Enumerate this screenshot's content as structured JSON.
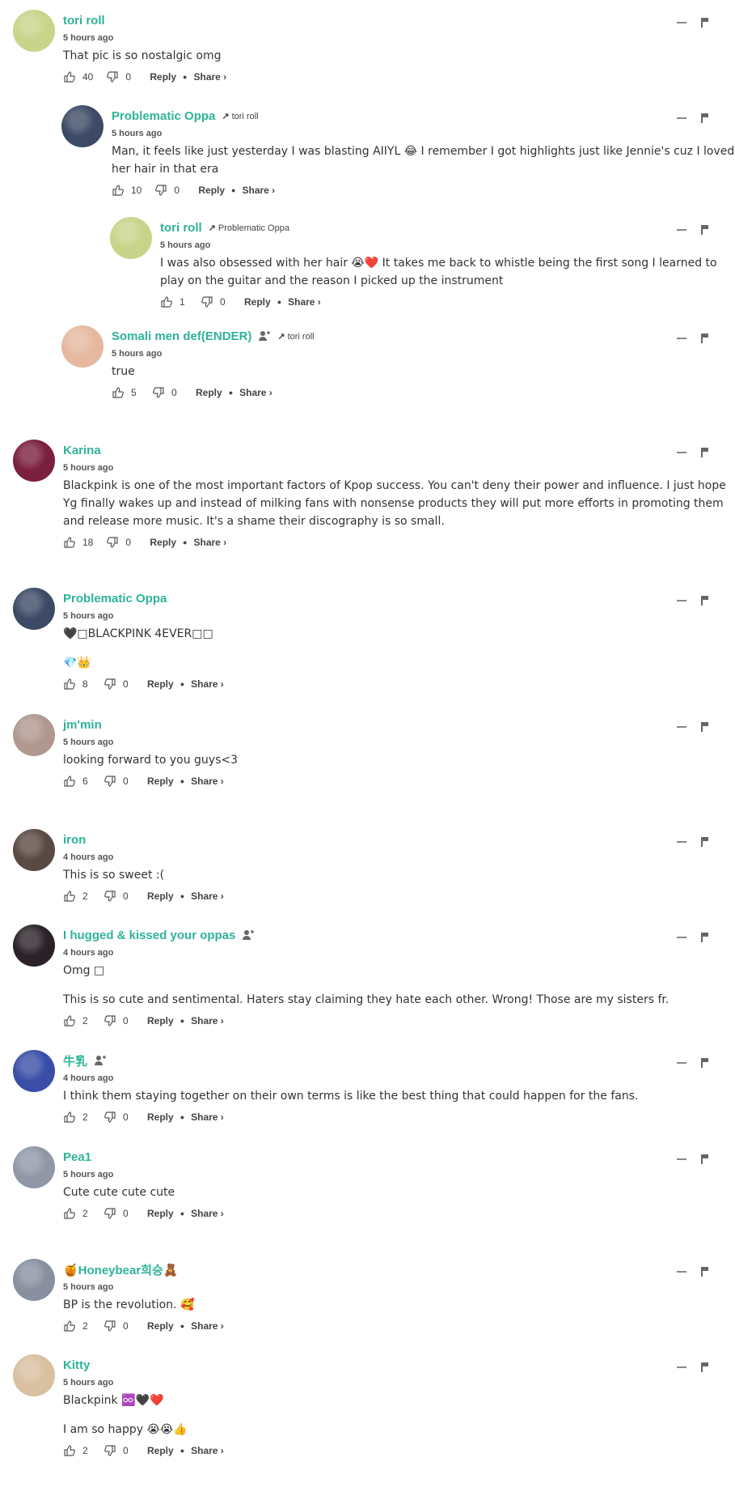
{
  "actions": {
    "reply": "Reply",
    "share": "Share ›"
  },
  "comments": [
    {
      "username": "tori roll",
      "time": "5 hours ago",
      "text": [
        "That pic is so nostalgic omg"
      ],
      "likes": "40",
      "dislikes": "0",
      "reply_to": "",
      "follow": false,
      "avatar_color": "#c8d48a"
    },
    {
      "username": "Problematic Oppa",
      "time": "5 hours ago",
      "text": [
        "Man, it feels like just yesterday I was blasting AIIYL 😂 I remember I got highlights just like Jennie's cuz I loved her hair in that era"
      ],
      "likes": "10",
      "dislikes": "0",
      "reply_to": "tori roll",
      "follow": false,
      "avatar_color": "#3d4a66"
    },
    {
      "username": "tori roll",
      "time": "5 hours ago",
      "text": [
        "I was also obsessed with her hair 😭❤️ It takes me back to whistle being the first song I learned to play on the guitar and the reason I picked up the instrument"
      ],
      "likes": "1",
      "dislikes": "0",
      "reply_to": "Problematic Oppa",
      "follow": false,
      "avatar_color": "#c8d48a"
    },
    {
      "username": "Somali men def(ENDER)",
      "time": "5 hours ago",
      "text": [
        "true"
      ],
      "likes": "5",
      "dislikes": "0",
      "reply_to": "tori roll",
      "follow": true,
      "avatar_color": "#e6b8a0"
    },
    {
      "username": "Karina",
      "time": "5 hours ago",
      "text": [
        "Blackpink is one of the most important factors of Kpop success. You can't deny their power and influence. I just hope Yg finally wakes up and instead of milking fans with nonsense products they will put more efforts in promoting them and release more music. It's a shame their discography is so small."
      ],
      "likes": "18",
      "dislikes": "0",
      "reply_to": "",
      "follow": false,
      "avatar_color": "#7a1f3d"
    },
    {
      "username": "Problematic Oppa",
      "time": "5 hours ago",
      "text": [
        "🖤□BLACKPINK 4EVER□□",
        "💎👑"
      ],
      "likes": "8",
      "dislikes": "0",
      "reply_to": "",
      "follow": false,
      "avatar_color": "#3d4a66"
    },
    {
      "username": "jm'min",
      "time": "5 hours ago",
      "text": [
        "looking forward to you guys<3"
      ],
      "likes": "6",
      "dislikes": "0",
      "reply_to": "",
      "follow": false,
      "avatar_color": "#b09890"
    },
    {
      "username": "iron",
      "time": "4 hours ago",
      "text": [
        "This is so sweet :("
      ],
      "likes": "2",
      "dislikes": "0",
      "reply_to": "",
      "follow": false,
      "avatar_color": "#5a4a44"
    },
    {
      "username": "I hugged & kissed your oppas",
      "time": "4 hours ago",
      "text": [
        "Omg □",
        "This is so cute and sentimental. Haters stay claiming they hate each other. Wrong! Those are my sisters fr."
      ],
      "likes": "2",
      "dislikes": "0",
      "reply_to": "",
      "follow": true,
      "avatar_color": "#2a2228"
    },
    {
      "username": "牛乳",
      "time": "4 hours ago",
      "text": [
        "I think them staying together on their own terms is like the best thing that could happen for the fans."
      ],
      "likes": "2",
      "dislikes": "0",
      "reply_to": "",
      "follow": true,
      "avatar_color": "#3a4ea8"
    },
    {
      "username": "Pea1",
      "time": "5 hours ago",
      "text": [
        "Cute cute cute cute"
      ],
      "likes": "2",
      "dislikes": "0",
      "reply_to": "",
      "follow": false,
      "avatar_color": "#9098a8"
    },
    {
      "username": "🍯Honeybear희승🧸",
      "time": "5 hours ago",
      "text": [
        "BP is the revolution. 🥰"
      ],
      "likes": "2",
      "dislikes": "0",
      "reply_to": "",
      "follow": false,
      "avatar_color": "#8890a0"
    },
    {
      "username": "Kitty",
      "time": "5 hours ago",
      "text": [
        "Blackpink ♾️🖤❤️",
        "I am so happy 😭😭👍"
      ],
      "likes": "2",
      "dislikes": "0",
      "reply_to": "",
      "follow": false,
      "avatar_color": "#d8c0a0"
    }
  ]
}
